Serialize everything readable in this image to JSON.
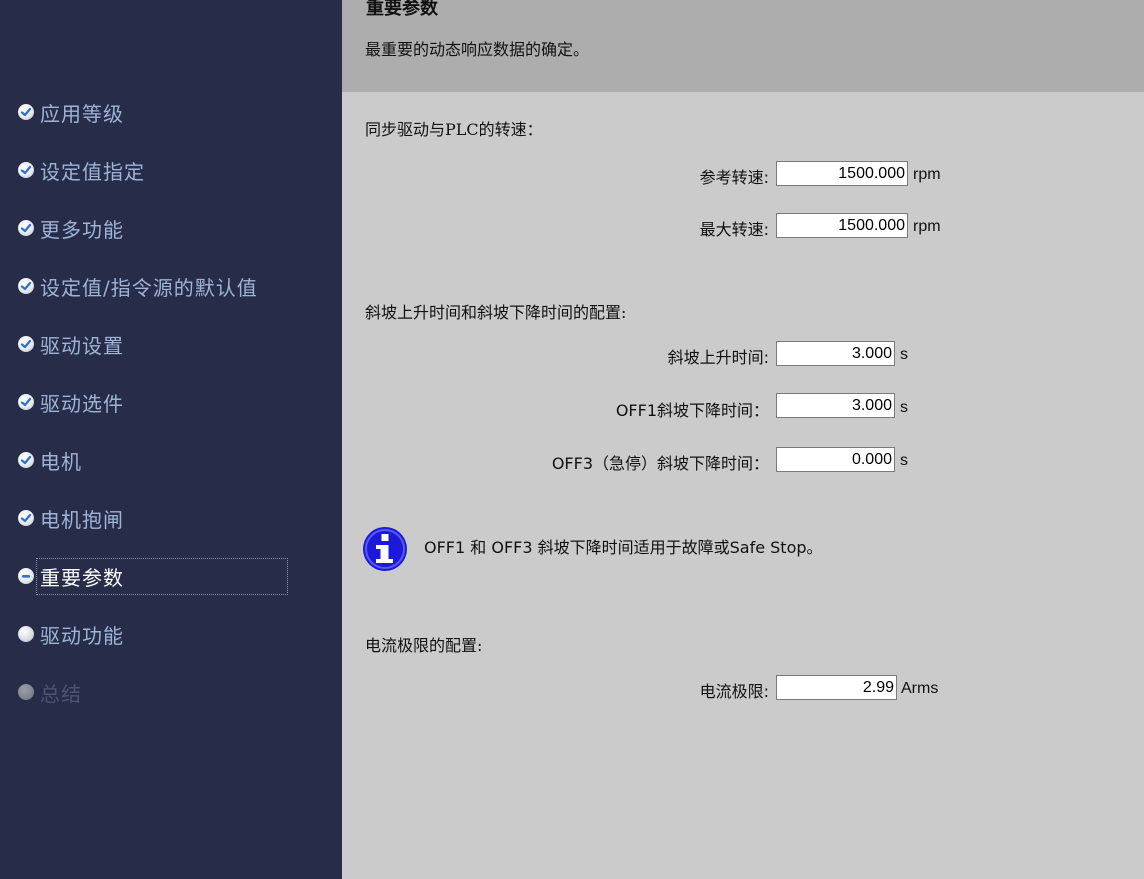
{
  "sidebar": {
    "items": [
      {
        "label": "应用等级",
        "status": "done"
      },
      {
        "label": "设定值指定",
        "status": "done"
      },
      {
        "label": "更多功能",
        "status": "done"
      },
      {
        "label": "设定值/指令源的默认值",
        "status": "done"
      },
      {
        "label": "驱动设置",
        "status": "done"
      },
      {
        "label": "驱动选件",
        "status": "done"
      },
      {
        "label": "电机",
        "status": "done"
      },
      {
        "label": "电机抱闸",
        "status": "done"
      },
      {
        "label": "重要参数",
        "status": "current"
      },
      {
        "label": "驱动功能",
        "status": "pending"
      },
      {
        "label": "总结",
        "status": "disabled"
      }
    ]
  },
  "header": {
    "title": "重要参数",
    "subtitle": "最重要的动态响应数据的确定。"
  },
  "speed": {
    "section_title": "同步驱动与PLC的转速：",
    "reference_label": "参考转速:",
    "reference_value": "1500.000",
    "reference_unit": "rpm",
    "max_label": "最大转速:",
    "max_value": "1500.000",
    "max_unit": "rpm"
  },
  "ramp": {
    "section_title": "斜坡上升时间和斜坡下降时间的配置:",
    "up_label": "斜坡上升时间:",
    "up_value": "3.000",
    "up_unit": "s",
    "off1_label": "OFF1斜坡下降时间：",
    "off1_value": "3.000",
    "off1_unit": "s",
    "off3_label": "OFF3（急停）斜坡下降时间：",
    "off3_value": "0.000",
    "off3_unit": "s"
  },
  "info": {
    "icon": "info-icon",
    "text": "OFF1 和 OFF3 斜坡下降时间适用于故障或Safe Stop。"
  },
  "current": {
    "section_title": "电流极限的配置:",
    "limit_label": "电流极限:",
    "limit_value": "2.99",
    "limit_unit": "Arms"
  },
  "colors": {
    "sidebar_bg": "#272d48",
    "sidebar_text": "#9fb3d6",
    "header_bg": "#adadad",
    "content_bg": "#cbcbcb",
    "info_blue": "#1a1ad8"
  }
}
